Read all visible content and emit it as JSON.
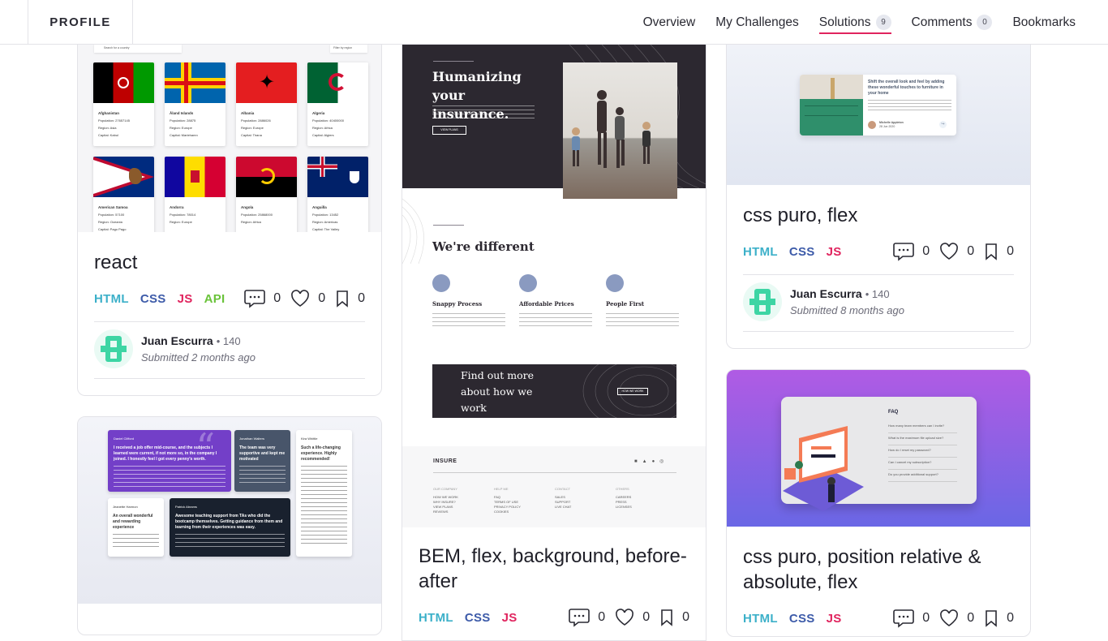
{
  "header": {
    "brand": "PROFILE",
    "nav": [
      {
        "label": "Overview",
        "count": null,
        "active": false
      },
      {
        "label": "My Challenges",
        "count": null,
        "active": false
      },
      {
        "label": "Solutions",
        "count": "9",
        "active": true
      },
      {
        "label": "Comments",
        "count": "0",
        "active": false
      },
      {
        "label": "Bookmarks",
        "count": null,
        "active": false
      }
    ]
  },
  "colors": {
    "accent": "#e0245e",
    "html": "#3cb0c9",
    "css": "#3d5ba9",
    "js": "#e0245e",
    "api": "#6ac33a"
  },
  "cards": {
    "react": {
      "title": "react",
      "tags": [
        "HTML",
        "CSS",
        "JS",
        "API"
      ],
      "comments": "0",
      "likes": "0",
      "bookmarks": "0",
      "author": "Juan Escurra",
      "points": "140",
      "submitted": "Submitted 2 months ago",
      "preview": {
        "search_placeholder": "Search for a country",
        "filter": "Filter by region",
        "countries": [
          {
            "name": "Afghanistan",
            "population": "Population: 27657145",
            "region": "Region: Asia",
            "capital": "Capital: Kabul"
          },
          {
            "name": "Åland Islands",
            "population": "Population: 28875",
            "region": "Region: Europe",
            "capital": "Capital: Mariehamn"
          },
          {
            "name": "Albania",
            "population": "Population: 2886026",
            "region": "Region: Europe",
            "capital": "Capital: Tirana"
          },
          {
            "name": "Algeria",
            "population": "Population: 40400000",
            "region": "Region: Africa",
            "capital": "Capital: Algiers"
          },
          {
            "name": "American Samoa",
            "population": "Population: 57100",
            "region": "Region: Oceania",
            "capital": "Capital: Pago Pago"
          },
          {
            "name": "Andorra",
            "population": "Population: 78014",
            "region": "Region: Europe",
            "capital": ""
          },
          {
            "name": "Angola",
            "population": "Population: 25868000",
            "region": "Region: Africa",
            "capital": ""
          },
          {
            "name": "Anguilla",
            "population": "Population: 13452",
            "region": "Region: Americas",
            "capital": "Capital: The Valley"
          }
        ]
      }
    },
    "bem": {
      "title": "BEM, flex, background, before-after",
      "tags": [
        "HTML",
        "CSS",
        "JS"
      ],
      "comments": "0",
      "likes": "0",
      "bookmarks": "0",
      "preview": {
        "hero_title": "Humanizing your insurance.",
        "hero_button": "VIEW PLANS",
        "different": "We're different",
        "features": [
          "Snappy Process",
          "Affordable Prices",
          "People First"
        ],
        "cta": "Find out more about how we work",
        "cta_button": "HOW WE WORK",
        "logo": "INSURE",
        "footer_cols": [
          {
            "head": "OUR COMPANY",
            "items": [
              "HOW WE WORK",
              "WHY INSURE?",
              "VIEW PLANS",
              "REVIEWS"
            ]
          },
          {
            "head": "HELP ME",
            "items": [
              "FAQ",
              "TERMS OF USE",
              "PRIVACY POLICY",
              "COOKIES"
            ]
          },
          {
            "head": "CONTACT",
            "items": [
              "SALES",
              "SUPPORT",
              "LIVE CHAT"
            ]
          },
          {
            "head": "OTHERS",
            "items": [
              "CAREERS",
              "PRESS",
              "LICENSES"
            ]
          }
        ]
      }
    },
    "flex": {
      "title": "css puro, flex",
      "tags": [
        "HTML",
        "CSS",
        "JS"
      ],
      "comments": "0",
      "likes": "0",
      "bookmarks": "0",
      "author": "Juan Escurra",
      "points": "140",
      "submitted": "Submitted 8 months ago",
      "preview": {
        "headline": "Shift the overall look and feel by adding these wonderful touches to furniture in your home",
        "author": "Michelle Appleton",
        "date": "28 Jun 2020"
      }
    },
    "position": {
      "title": "css puro, position relative & absolute, flex",
      "tags": [
        "HTML",
        "CSS",
        "JS"
      ],
      "comments": "0",
      "likes": "0",
      "bookmarks": "0",
      "preview": {
        "faq_title": "FAQ",
        "questions": [
          "How many team members can I invite?",
          "What is the maximum file upload size?",
          "How do I reset my password?",
          "Can I cancel my subscription?",
          "Do you provide additional support?"
        ]
      }
    },
    "testimonials": {
      "preview": {
        "t1_head": "I received a job offer mid-course, and the subjects I learned were current, if not more so, in the company I joined. I honestly feel I got every penny's worth.",
        "t2_head": "The team was very supportive and kept me motivated",
        "t3_head": "Such a life-changing experience. Highly recommended!",
        "t4_head": "An overall wonderful and rewarding experience",
        "t5_head": "Awesome teaching support from TAs who did the bootcamp themselves. Getting guidance from them and learning from their experiences was easy."
      }
    }
  }
}
